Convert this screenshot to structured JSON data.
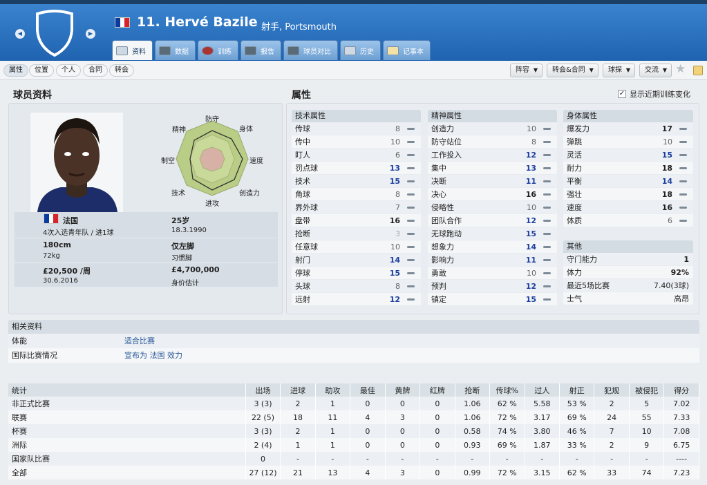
{
  "header": {
    "player_title": "11. Hervé Bazile",
    "subtitle": "射手, Portsmouth",
    "tabs": [
      {
        "label": "资料",
        "icon": "profile-icon"
      },
      {
        "label": "数据",
        "icon": "stats-icon"
      },
      {
        "label": "训练",
        "icon": "training-icon"
      },
      {
        "label": "报告",
        "icon": "report-icon"
      },
      {
        "label": "球员对比",
        "icon": "compare-icon"
      },
      {
        "label": "历史",
        "icon": "history-icon"
      },
      {
        "label": "记事本",
        "icon": "notebook-icon"
      }
    ]
  },
  "subnav": {
    "tabs": [
      "属性",
      "位置",
      "个人",
      "合同",
      "转会"
    ],
    "dropdowns": [
      "阵容",
      "转会&合同",
      "球探",
      "交流"
    ]
  },
  "profile": {
    "section_title": "球员资料",
    "radar_labels": [
      "防守",
      "身体",
      "速度",
      "创造力",
      "进攻",
      "技术",
      "制空",
      "精神"
    ],
    "nation": "法国",
    "nation_caps": "4次入选青年队 / 进1球",
    "age": "25岁",
    "dob": "18.3.1990",
    "height": "180cm",
    "weight": "72kg",
    "foot": "仅左脚",
    "foot_note": "习惯脚",
    "wage": "£20,500 /周",
    "contract_end": "30.6.2016",
    "value": "£4,700,000",
    "value_label": "身价估计"
  },
  "attributes": {
    "section_title": "属性",
    "show_training_label": "显示近期训练变化",
    "technical": {
      "title": "技术属性",
      "rows": [
        {
          "label": "传球",
          "value": "8"
        },
        {
          "label": "传中",
          "value": "10"
        },
        {
          "label": "盯人",
          "value": "6"
        },
        {
          "label": "罚点球",
          "value": "13"
        },
        {
          "label": "技术",
          "value": "15"
        },
        {
          "label": "角球",
          "value": "8"
        },
        {
          "label": "界外球",
          "value": "7"
        },
        {
          "label": "盘带",
          "value": "16"
        },
        {
          "label": "抢断",
          "value": "3"
        },
        {
          "label": "任意球",
          "value": "10"
        },
        {
          "label": "射门",
          "value": "14"
        },
        {
          "label": "停球",
          "value": "15"
        },
        {
          "label": "头球",
          "value": "8"
        },
        {
          "label": "远射",
          "value": "12"
        }
      ]
    },
    "mental": {
      "title": "精神属性",
      "rows": [
        {
          "label": "创造力",
          "value": "10"
        },
        {
          "label": "防守站位",
          "value": "8"
        },
        {
          "label": "工作投入",
          "value": "12"
        },
        {
          "label": "集中",
          "value": "13"
        },
        {
          "label": "决断",
          "value": "11"
        },
        {
          "label": "决心",
          "value": "16"
        },
        {
          "label": "侵略性",
          "value": "10"
        },
        {
          "label": "团队合作",
          "value": "12"
        },
        {
          "label": "无球跑动",
          "value": "15"
        },
        {
          "label": "想象力",
          "value": "14"
        },
        {
          "label": "影响力",
          "value": "11"
        },
        {
          "label": "勇敢",
          "value": "10"
        },
        {
          "label": "预判",
          "value": "12"
        },
        {
          "label": "镇定",
          "value": "15"
        }
      ]
    },
    "physical": {
      "title": "身体属性",
      "rows": [
        {
          "label": "爆发力",
          "value": "17"
        },
        {
          "label": "弹跳",
          "value": "10"
        },
        {
          "label": "灵活",
          "value": "15"
        },
        {
          "label": "耐力",
          "value": "18"
        },
        {
          "label": "平衡",
          "value": "14"
        },
        {
          "label": "强壮",
          "value": "18"
        },
        {
          "label": "速度",
          "value": "16"
        },
        {
          "label": "体质",
          "value": "6"
        }
      ]
    },
    "other": {
      "title": "其他",
      "rows": [
        {
          "label": "守门能力",
          "value": "1"
        },
        {
          "label": "体力",
          "value": "92%"
        },
        {
          "label": "最近5场比赛",
          "value": "7.40(3球)"
        },
        {
          "label": "士气",
          "value": "高昂"
        }
      ]
    }
  },
  "related": {
    "title": "相关资料",
    "rows": [
      {
        "key": "体能",
        "value": "适合比赛"
      },
      {
        "key": "国际比赛情况",
        "value": "宣布为 法国 效力"
      }
    ]
  },
  "stats": {
    "headers": [
      "统计",
      "出场",
      "进球",
      "助攻",
      "最佳",
      "黄牌",
      "红牌",
      "抢断",
      "传球%",
      "过人",
      "射正",
      "犯规",
      "被侵犯",
      "得分"
    ],
    "rows": [
      [
        "非正式比赛",
        "3 (3)",
        "2",
        "1",
        "0",
        "0",
        "0",
        "1.06",
        "62 %",
        "5.58",
        "53 %",
        "2",
        "5",
        "7.02"
      ],
      [
        "联赛",
        "22 (5)",
        "18",
        "11",
        "4",
        "3",
        "0",
        "1.06",
        "72 %",
        "3.17",
        "69 %",
        "24",
        "55",
        "7.33"
      ],
      [
        "杯赛",
        "3 (3)",
        "2",
        "1",
        "0",
        "0",
        "0",
        "0.58",
        "74 %",
        "3.80",
        "46 %",
        "7",
        "10",
        "7.08"
      ],
      [
        "洲际",
        "2 (4)",
        "1",
        "1",
        "0",
        "0",
        "0",
        "0.93",
        "69 %",
        "1.87",
        "33 %",
        "2",
        "9",
        "6.75"
      ],
      [
        "国家队比赛",
        "0",
        "-",
        "-",
        "-",
        "-",
        "-",
        "-",
        "-",
        "-",
        "-",
        "-",
        "-",
        "----"
      ],
      [
        "全部",
        "27 (12)",
        "21",
        "13",
        "4",
        "3",
        "0",
        "0.99",
        "72 %",
        "3.15",
        "62 %",
        "33",
        "74",
        "7.23"
      ]
    ]
  },
  "colors": {
    "header_blue": "#1f63b0",
    "accent_value": "#1c3f9e",
    "flag": [
      "#0a3a9e",
      "#ffffff",
      "#d8232a"
    ]
  }
}
